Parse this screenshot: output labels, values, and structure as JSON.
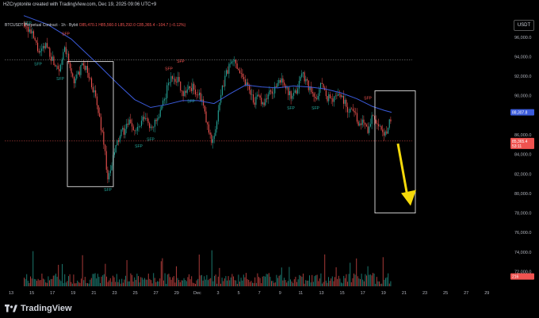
{
  "header": {
    "credit": "HZCryptonite created with TradingView.com, Dec 19, 2025 09:06 UTC+9"
  },
  "legend": {
    "symbol": "BTCUSDT Perpetual Contract · 1h · Bybit",
    "values": "O85,470.1 H85,560.0 L85,292.0 C85,365.4 −104.7 (−0.12%)"
  },
  "currency_button": "USDT",
  "colors": {
    "up": "#26a69a",
    "down": "#ef5350",
    "ma": "#3b5bdb",
    "arrow": "#f5d90a",
    "box": "#e0e0e0"
  },
  "chart_data": {
    "type": "candlestick",
    "ylim": [
      70500,
      98500
    ],
    "y_ticks": [
      "96,000.0",
      "94,000.0",
      "92,000.0",
      "90,000.0",
      "86,000.0",
      "84,000.0",
      "82,000.0",
      "80,000.0",
      "78,000.0",
      "76,000.0",
      "74,000.0",
      "72,000.0"
    ],
    "x_ticks": [
      "13",
      "15",
      "17",
      "19",
      "21",
      "23",
      "25",
      "27",
      "29",
      "Dec",
      "3",
      "5",
      "7",
      "9",
      "11",
      "13",
      "15",
      "17",
      "19",
      "21",
      "23",
      "25",
      "27",
      "29"
    ],
    "price_badges": [
      {
        "label": "88,307.8",
        "value": 88307.8,
        "color": "#3b5bdb"
      },
      {
        "label": "85,365.4",
        "value": 85365.4,
        "color": "#ef5350",
        "sub": "53:11"
      },
      {
        "label": "216",
        "value": 71500,
        "color": "#ef5350"
      }
    ],
    "dashed_levels": [
      93650,
      85365
    ],
    "sfp_labels": [
      {
        "text": "SFP",
        "x": 35,
        "price": 97300,
        "color": "#26a69a"
      },
      {
        "text": "SFP",
        "x": 83,
        "price": 96200,
        "color": "#ef5350"
      },
      {
        "text": "SFP",
        "x": 48,
        "price": 93100,
        "color": "#26a69a"
      },
      {
        "text": "SFP",
        "x": 76,
        "price": 91600,
        "color": "#26a69a"
      },
      {
        "text": "SFP",
        "x": 136,
        "price": 80250,
        "color": "#26a69a"
      },
      {
        "text": "SFP",
        "x": 175,
        "price": 84700,
        "color": "#26a69a"
      },
      {
        "text": "SFP",
        "x": 190,
        "price": 85400,
        "color": "#26a69a"
      },
      {
        "text": "SFP",
        "x": 213,
        "price": 92600,
        "color": "#ef5350"
      },
      {
        "text": "SFP",
        "x": 228,
        "price": 93400,
        "color": "#ef5350"
      },
      {
        "text": "SFP",
        "x": 241,
        "price": 89300,
        "color": "#26a69a"
      },
      {
        "text": "SFP",
        "x": 367,
        "price": 88600,
        "color": "#26a69a"
      },
      {
        "text": "SFP",
        "x": 398,
        "price": 88600,
        "color": "#26a69a"
      },
      {
        "text": "SFP",
        "x": 464,
        "price": 89600,
        "color": "#ef5350"
      }
    ],
    "boxes": [
      {
        "x0": 85,
        "x1": 143,
        "price_top": 93500,
        "price_bottom": 80700
      },
      {
        "x0": 473,
        "x1": 524,
        "price_top": 90500,
        "price_bottom": 78000
      }
    ],
    "arrow": {
      "x0": 502,
      "price0": 85100,
      "x1": 516,
      "price1": 78900
    },
    "close_path": [
      [
        30,
        97500
      ],
      [
        40,
        96200
      ],
      [
        50,
        94200
      ],
      [
        58,
        95300
      ],
      [
        66,
        93600
      ],
      [
        74,
        92900
      ],
      [
        82,
        94800
      ],
      [
        88,
        92600
      ],
      [
        94,
        91400
      ],
      [
        100,
        92600
      ],
      [
        106,
        93200
      ],
      [
        112,
        91900
      ],
      [
        118,
        90400
      ],
      [
        124,
        88100
      ],
      [
        130,
        85500
      ],
      [
        136,
        81200
      ],
      [
        140,
        82800
      ],
      [
        146,
        84900
      ],
      [
        152,
        86100
      ],
      [
        158,
        86600
      ],
      [
        164,
        87400
      ],
      [
        170,
        86300
      ],
      [
        176,
        86900
      ],
      [
        182,
        87800
      ],
      [
        188,
        86900
      ],
      [
        194,
        87100
      ],
      [
        200,
        87700
      ],
      [
        206,
        89400
      ],
      [
        212,
        91300
      ],
      [
        218,
        92000
      ],
      [
        224,
        91600
      ],
      [
        230,
        90300
      ],
      [
        236,
        90700
      ],
      [
        242,
        90900
      ],
      [
        248,
        90200
      ],
      [
        254,
        89600
      ],
      [
        260,
        87200
      ],
      [
        266,
        85300
      ],
      [
        272,
        86700
      ],
      [
        278,
        89900
      ],
      [
        284,
        92200
      ],
      [
        290,
        93200
      ],
      [
        296,
        93600
      ],
      [
        302,
        92600
      ],
      [
        308,
        91500
      ],
      [
        314,
        90800
      ],
      [
        320,
        89400
      ],
      [
        326,
        89800
      ],
      [
        332,
        89300
      ],
      [
        338,
        90100
      ],
      [
        344,
        90500
      ],
      [
        350,
        91200
      ],
      [
        356,
        91800
      ],
      [
        362,
        90400
      ],
      [
        368,
        89600
      ],
      [
        374,
        90600
      ],
      [
        380,
        92400
      ],
      [
        386,
        91600
      ],
      [
        392,
        90300
      ],
      [
        398,
        89400
      ],
      [
        404,
        91400
      ],
      [
        410,
        90100
      ],
      [
        416,
        89600
      ],
      [
        422,
        89900
      ],
      [
        428,
        90300
      ],
      [
        434,
        89400
      ],
      [
        440,
        88400
      ],
      [
        446,
        88900
      ],
      [
        452,
        86700
      ],
      [
        458,
        87600
      ],
      [
        464,
        86500
      ],
      [
        470,
        88300
      ],
      [
        476,
        86900
      ],
      [
        482,
        85900
      ],
      [
        488,
        86600
      ],
      [
        492,
        87900
      ],
      [
        494,
        85365
      ]
    ],
    "ma_path": [
      [
        30,
        98200
      ],
      [
        60,
        97300
      ],
      [
        90,
        95800
      ],
      [
        120,
        93500
      ],
      [
        150,
        91100
      ],
      [
        170,
        89600
      ],
      [
        190,
        88800
      ],
      [
        210,
        89100
      ],
      [
        230,
        89500
      ],
      [
        250,
        89500
      ],
      [
        270,
        89200
      ],
      [
        290,
        90200
      ],
      [
        310,
        91100
      ],
      [
        330,
        90900
      ],
      [
        350,
        90800
      ],
      [
        370,
        91000
      ],
      [
        390,
        90900
      ],
      [
        410,
        90700
      ],
      [
        430,
        90300
      ],
      [
        450,
        89700
      ],
      [
        470,
        88900
      ],
      [
        485,
        88500
      ],
      [
        494,
        88307
      ]
    ]
  }
}
